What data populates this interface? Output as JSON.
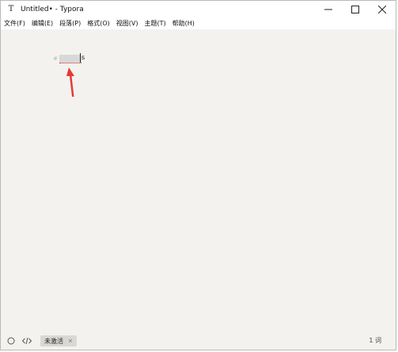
{
  "window": {
    "title": "Untitled• - Typora",
    "app_icon": "T"
  },
  "menu": {
    "items": [
      {
        "label": "文件(F)"
      },
      {
        "label": "编辑(E)"
      },
      {
        "label": "段落(P)"
      },
      {
        "label": "格式(O)"
      },
      {
        "label": "视图(V)"
      },
      {
        "label": "主题(T)"
      },
      {
        "label": "帮助(H)"
      }
    ]
  },
  "editor": {
    "heading_mark": "#",
    "cursor_char": "s"
  },
  "status": {
    "tab_label": "未激活",
    "tab_close": "×",
    "word_count": "1 词"
  },
  "colors": {
    "editor_background": "#f3f2ef",
    "annotation_arrow": "#e53935"
  }
}
